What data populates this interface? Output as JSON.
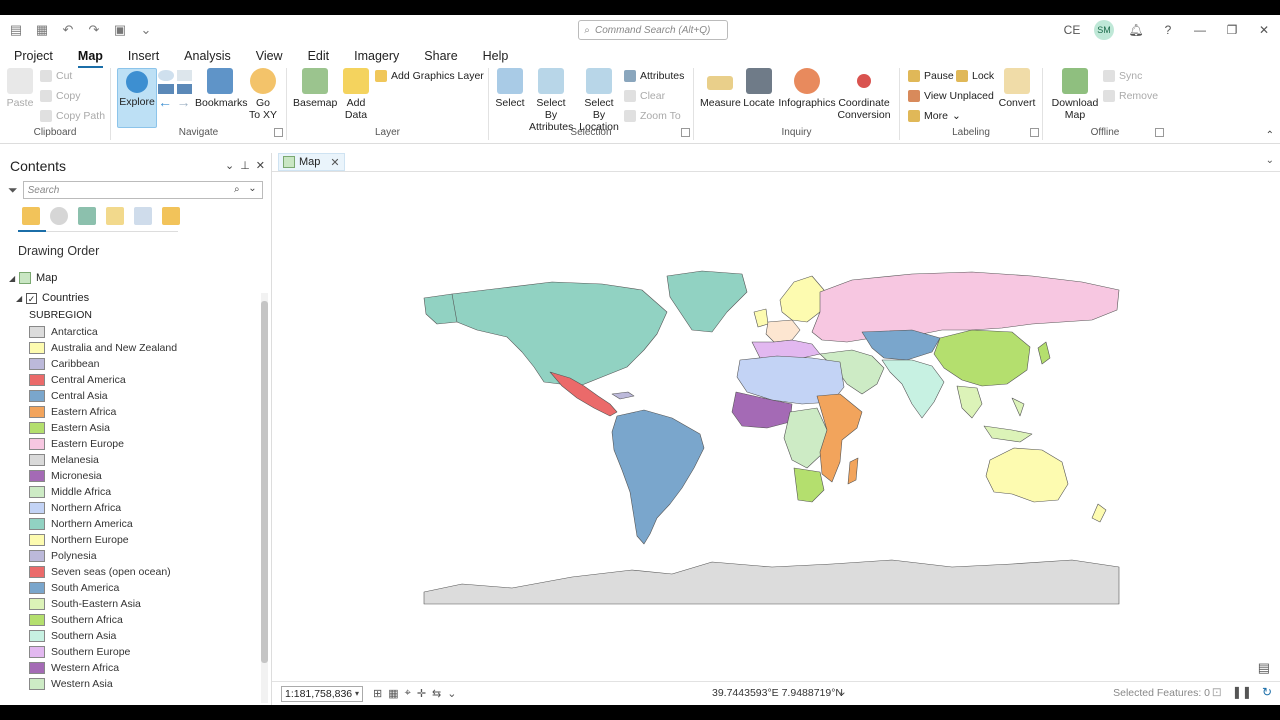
{
  "command_search": {
    "placeholder": "Command Search (Alt+Q)"
  },
  "user": {
    "initials_text": "CE",
    "avatar_initials": "SM"
  },
  "tabs": [
    "Project",
    "Map",
    "Insert",
    "Analysis",
    "View",
    "Edit",
    "Imagery",
    "Share",
    "Help"
  ],
  "active_tab": "Map",
  "ribbon": {
    "clipboard": {
      "label": "Clipboard",
      "paste": "Paste",
      "cut": "Cut",
      "copy": "Copy",
      "copy_path": "Copy Path"
    },
    "navigate": {
      "label": "Navigate",
      "explore": "Explore",
      "bookmarks": "Bookmarks",
      "goto_1": "Go",
      "goto_2": "To XY"
    },
    "layer": {
      "label": "Layer",
      "basemap": "Basemap",
      "add_data_1": "Add",
      "add_data_2": "Data",
      "add_graphics": "Add Graphics Layer"
    },
    "selection": {
      "label": "Selection",
      "select": "Select",
      "sba_1": "Select By",
      "sba_2": "Attributes",
      "sbl_1": "Select By",
      "sbl_2": "Location",
      "attributes": "Attributes",
      "clear": "Clear",
      "zoom_to": "Zoom To"
    },
    "inquiry": {
      "label": "Inquiry",
      "measure": "Measure",
      "locate": "Locate",
      "infographics": "Infographics",
      "coord_1": "Coordinate",
      "coord_2": "Conversion"
    },
    "labeling": {
      "label": "Labeling",
      "pause": "Pause",
      "lock": "Lock",
      "view_unplaced": "View Unplaced",
      "more": "More",
      "convert": "Convert"
    },
    "offline": {
      "label": "Offline",
      "download_1": "Download",
      "download_2": "Map",
      "sync": "Sync",
      "remove": "Remove"
    }
  },
  "contents": {
    "title": "Contents",
    "search_placeholder": "Search",
    "drawing_order": "Drawing Order",
    "map_name": "Map",
    "layer_name": "Countries",
    "field_name": "SUBREGION",
    "legend": [
      {
        "label": "Antarctica",
        "color": "#dcdcdc"
      },
      {
        "label": "Australia and New Zealand",
        "color": "#fdfbb0"
      },
      {
        "label": "Caribbean",
        "color": "#bcb9da"
      },
      {
        "label": "Central America",
        "color": "#eb6a6a"
      },
      {
        "label": "Central Asia",
        "color": "#7aa6cc"
      },
      {
        "label": "Eastern Africa",
        "color": "#f2a45c"
      },
      {
        "label": "Eastern Asia",
        "color": "#b4df6e"
      },
      {
        "label": "Eastern Europe",
        "color": "#f7c7e1"
      },
      {
        "label": "Melanesia",
        "color": "#d9d9d9"
      },
      {
        "label": "Micronesia",
        "color": "#a46ab5"
      },
      {
        "label": "Middle Africa",
        "color": "#cdebc5"
      },
      {
        "label": "Northern Africa",
        "color": "#c3d3f5"
      },
      {
        "label": "Northern America",
        "color": "#91d2c2"
      },
      {
        "label": "Northern Europe",
        "color": "#fdfbb0"
      },
      {
        "label": "Polynesia",
        "color": "#bcb9da"
      },
      {
        "label": "Seven seas (open ocean)",
        "color": "#eb6a6a"
      },
      {
        "label": "South America",
        "color": "#7aa6cc"
      },
      {
        "label": "South-Eastern Asia",
        "color": "#dcf3b8"
      },
      {
        "label": "Southern Africa",
        "color": "#b4df6e"
      },
      {
        "label": "Southern Asia",
        "color": "#c7f1e2"
      },
      {
        "label": "Southern Europe",
        "color": "#e2b8f0"
      },
      {
        "label": "Western Africa",
        "color": "#a46ab5"
      },
      {
        "label": "Western Asia",
        "color": "#cdebc5"
      }
    ]
  },
  "map_tab": {
    "label": "Map"
  },
  "status": {
    "scale": "1:181,758,836",
    "coordinates": "39.7443593°E 7.9488719°N",
    "selected_features": "Selected Features: 0"
  }
}
